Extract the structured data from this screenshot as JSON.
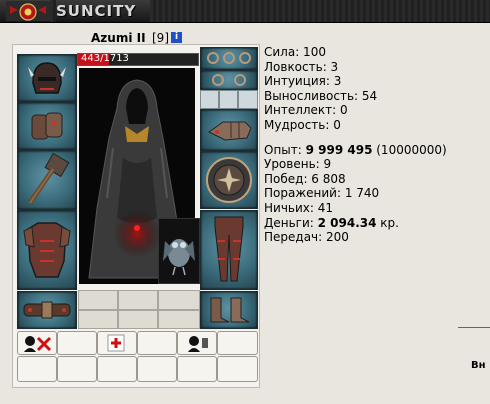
{
  "header": {
    "site_name": "SUNCITY"
  },
  "character": {
    "name": "Azumi II",
    "level": "[9]",
    "info_label": "i",
    "hp_current": "443",
    "hp_max": "1713",
    "hp_fraction": 0.259
  },
  "stats": {
    "strength": "Сила: 100",
    "agility": "Ловкость: 3",
    "intuition": "Интуиция: 3",
    "endurance": "Выносливость: 54",
    "intellect": "Интеллект: 0",
    "wisdom": "Мудрость: 0"
  },
  "progress": {
    "exp_label": "Опыт: ",
    "exp_value": "9 999 495",
    "exp_next": " (10000000)",
    "level": "Уровень: 9",
    "wins": "Побед: 6 808",
    "losses": "Поражений: 1 740",
    "draws": "Ничьих: 41",
    "money_label": "Деньги: ",
    "money_value": "2 094.34",
    "money_unit": " кр.",
    "transfers": "Передач: 200"
  },
  "right_edge_text": "Вн",
  "icons": {
    "helmet": "helmet-icon",
    "bracers": "bracers-icon",
    "hammer": "hammer-icon",
    "armor": "chest-armor-icon",
    "belt": "belt-icon",
    "rings": "rings-icon",
    "gloves": "gloves-icon",
    "shield": "shield-icon",
    "greaves": "greaves-icon",
    "boots": "boots-icon",
    "pet": "owl-pet-icon"
  },
  "colors": {
    "hp": "#c4121b",
    "slot": "#3c6d7d",
    "header": "#1e1e1e"
  }
}
